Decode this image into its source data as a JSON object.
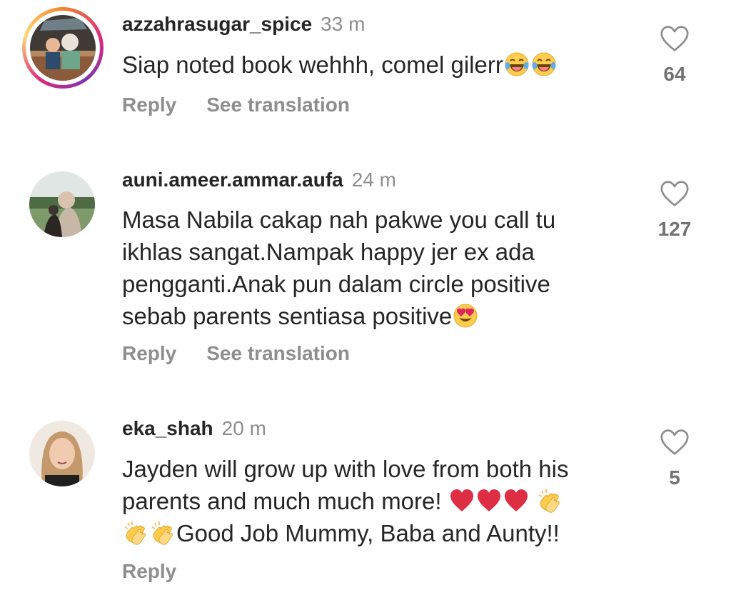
{
  "comments": [
    {
      "username": "azzahrasugar_spice",
      "time": "33 m",
      "text": "Siap noted book wehhh, comel gilerr",
      "text_emojis": [
        "laughing-tears-emoji",
        "laughing-tears-emoji"
      ],
      "has_story": true,
      "reply_label": "Reply",
      "translate_label": "See translation",
      "likes": "64"
    },
    {
      "username": "auni.ameer.ammar.aufa",
      "time": "24 m",
      "lines": [
        "Masa Nabila cakap nah pakwe you call tu",
        "ikhlas sangat.Nampak happy jer ex ada",
        "pengganti.Anak pun dalam circle positive",
        "sebab parents sentiasa positive"
      ],
      "text_emojis": [
        "heart-eyes-emoji"
      ],
      "has_story": false,
      "reply_label": "Reply",
      "translate_label": "See translation",
      "likes": "127"
    },
    {
      "username": "eka_shah",
      "time": "20 m",
      "lines": [
        "Jayden will grow up with love from both his",
        "parents and much much more!",
        "Good Job Mummy, Baba and Aunty!!"
      ],
      "text_emojis": [
        "red-heart-emoji",
        "red-heart-emoji",
        "red-heart-emoji",
        "clapping-hands-emoji",
        "clapping-hands-emoji",
        "clapping-hands-emoji"
      ],
      "has_story": false,
      "reply_label": "Reply",
      "likes": "5"
    }
  ],
  "colors": {
    "text": "#262626",
    "secondary": "#8e8e8e",
    "like_count": "#737373",
    "background": "#ffffff"
  }
}
